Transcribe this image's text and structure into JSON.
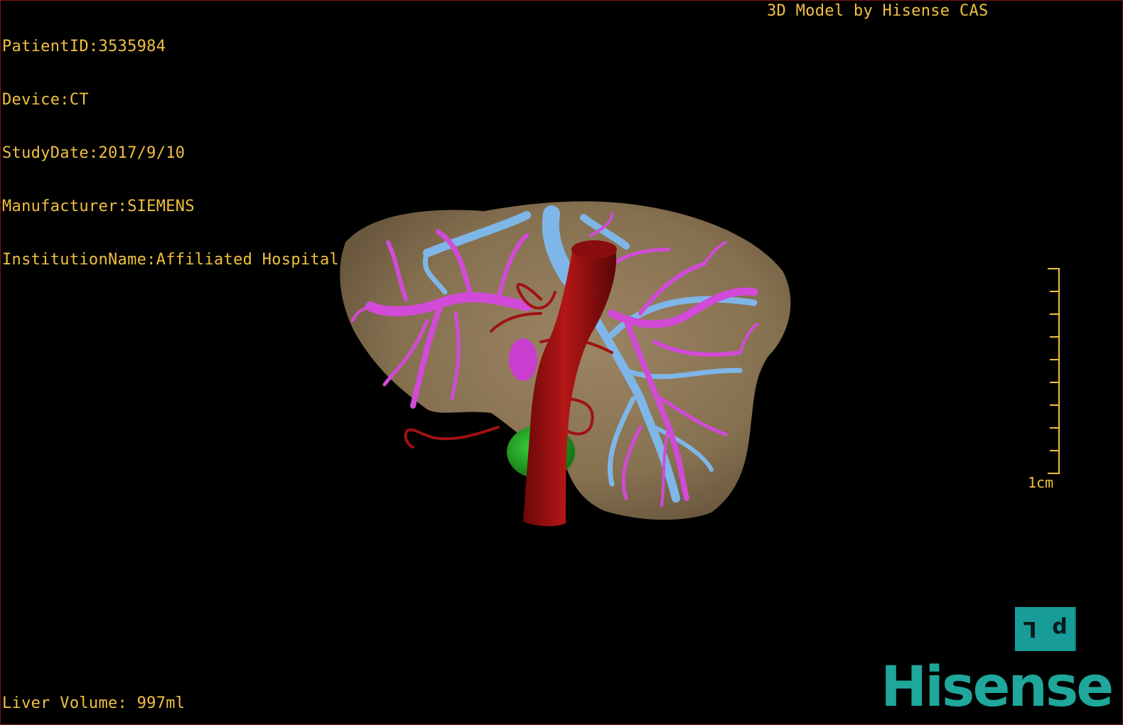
{
  "header": {
    "patient_id": "PatientID:3535984",
    "device": "Device:CT",
    "study_date": "StudyDate:2017/9/10",
    "manufacturer": "Manufacturer:SIEMENS",
    "institution": "InstitutionName:Affiliated Hospital Qingdao University-C",
    "model_credit": "3D Model by Hisense CAS"
  },
  "footer": {
    "liver_volume": "Liver Volume: 997ml"
  },
  "scale": {
    "label": "1cm"
  },
  "orientation": {
    "left_glyph": "L",
    "right_glyph": "p"
  },
  "brand": {
    "logo_text": "Hisense",
    "color": "#1ea79a"
  },
  "colors": {
    "overlay_text": "#f0c040",
    "liver": "#8a7458",
    "portal_vein": "#d24ad8",
    "hepatic_vein": "#7fb6e8",
    "artery_ivc": "#9e1010",
    "gallbladder": "#1fa81f"
  },
  "icons": [
    "orientation-cube-icon",
    "scale-bar-icon"
  ]
}
